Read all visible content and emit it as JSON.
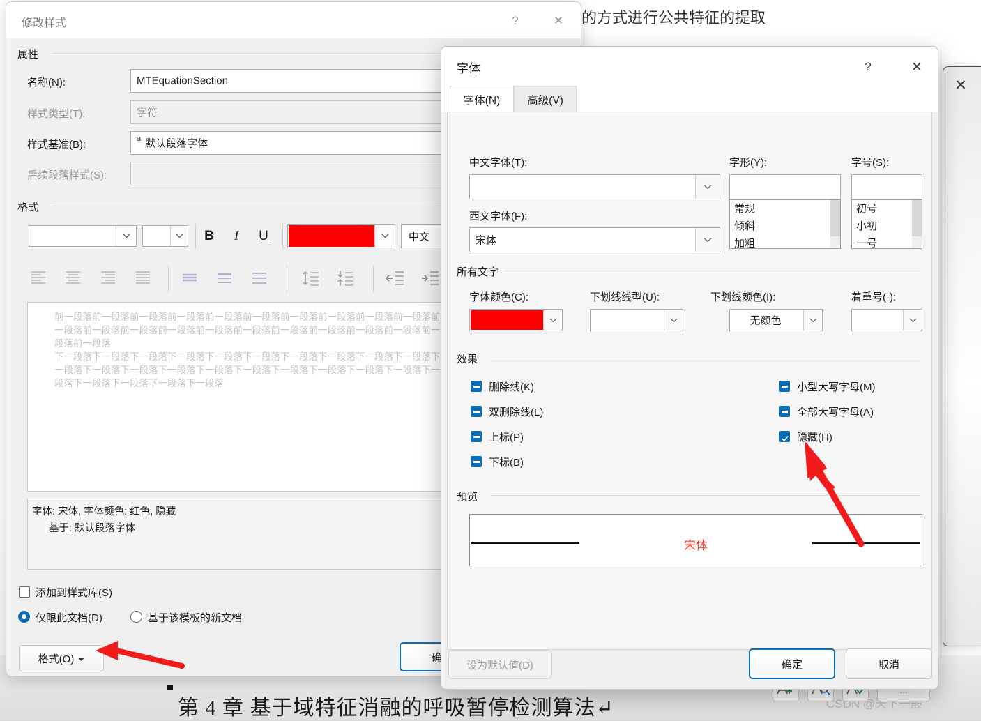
{
  "document": {
    "top_text": "的方式进行公共特征的提取",
    "heading": "第 4 章 基于域特征消融的呼吸暂停检测算法↵",
    "watermark": "CSDN @天下一般"
  },
  "style_dialog": {
    "title": "修改样式",
    "help_label": "?",
    "close_label": "✕",
    "properties": {
      "group_label": "属性",
      "fields": [
        {
          "label": "名称(N):",
          "value": "MTEquationSection",
          "disabled": false
        },
        {
          "label": "样式类型(T):",
          "value": "字符",
          "disabled": true
        },
        {
          "label": "样式基准(B):",
          "value": "默认段落字体",
          "prefix": "a",
          "disabled": false
        },
        {
          "label": "后续段落样式(S):",
          "value": "",
          "disabled": true
        }
      ]
    },
    "format": {
      "group_label": "格式",
      "font_family_value": "",
      "font_size_value": "",
      "bold_label": "B",
      "italic_label": "I",
      "underline_label": "U",
      "font_color": "#FF0000",
      "language_label": "中文",
      "align_icons": [
        "align-left-icon",
        "align-center-icon",
        "align-right-icon",
        "align-justify-icon"
      ],
      "spacing_icons": [
        "line-spacing-single-icon",
        "line-spacing-1.5-icon",
        "line-spacing-double-icon"
      ],
      "para-space_icons": [
        "space-before-icon",
        "space-after-icon"
      ],
      "indent_icons": [
        "decrease-indent-icon",
        "increase-indent-icon"
      ]
    },
    "preview_paragraph": "前一段落前一段落前一段落前一段落前一段落前一段落前一段落前一段落前一段落前一段落前一段落前一段落前一段落前一段落前一段落前一段落前一段落前一段落前一段落前一段落前一段落前一段落",
    "preview_paragraph_after": "下一段落下一段落下一段落下一段落下一段落下一段落下一段落下一段落下一段落下一段落下一段落下一段落下一段落下一段落下一段落下一段落下一段落下一段落下一段落下一段落下一段落下一段落下一段落下一段落下一段落",
    "description_line1": "字体: 宋体, 字体颜色: 红色, 隐藏",
    "description_line2": "基于: 默认段落字体",
    "add_to_gallery_label": "添加到样式库(S)",
    "add_to_gallery_checked": false,
    "scope_options": [
      {
        "label": "仅限此文档(D)",
        "selected": true
      },
      {
        "label": "基于该模板的新文档",
        "selected": false
      }
    ],
    "format_button_label": "格式(O)",
    "ok_button_label": "确定"
  },
  "font_dialog": {
    "title": "字体",
    "help_label": "?",
    "close_label": "✕",
    "tabs": [
      {
        "label": "字体(N)",
        "active": true
      },
      {
        "label": "高级(V)",
        "active": false
      }
    ],
    "chinese_font": {
      "label": "中文字体(T):",
      "value": ""
    },
    "western_font": {
      "label": "西文字体(F):",
      "value": "宋体"
    },
    "font_style": {
      "label": "字形(Y):",
      "value": "",
      "options": [
        "常规",
        "倾斜",
        "加粗"
      ]
    },
    "font_size": {
      "label": "字号(S):",
      "value": "",
      "options": [
        "初号",
        "小初",
        "一号"
      ]
    },
    "all_text": {
      "group_label": "所有文字",
      "font_color": {
        "label": "字体颜色(C):",
        "value": "",
        "swatch": "#FF0000"
      },
      "underline_style": {
        "label": "下划线线型(U):",
        "value": ""
      },
      "underline_color": {
        "label": "下划线颜色(I):",
        "value": "无颜色"
      },
      "emphasis_mark": {
        "label": "着重号(·):",
        "value": ""
      }
    },
    "effects": {
      "group_label": "效果",
      "left": [
        {
          "label": "删除线(K)",
          "state": "indeterminate"
        },
        {
          "label": "双删除线(L)",
          "state": "indeterminate"
        },
        {
          "label": "上标(P)",
          "state": "indeterminate"
        },
        {
          "label": "下标(B)",
          "state": "indeterminate"
        }
      ],
      "right": [
        {
          "label": "小型大写字母(M)",
          "state": "indeterminate"
        },
        {
          "label": "全部大写字母(A)",
          "state": "indeterminate"
        },
        {
          "label": "隐藏(H)",
          "state": "checked"
        }
      ]
    },
    "preview": {
      "group_label": "预览",
      "sample_text": "宋体",
      "sample_color": "#FF3B30"
    },
    "set_default_label": "设为默认值(D)",
    "ok_label": "确定",
    "cancel_label": "取消"
  },
  "rear_window": {
    "close_label": "✕"
  },
  "annotations": {
    "arrow_color": "#F21B1B",
    "arrow_1_target": "隐藏(H) 复选框",
    "arrow_2_target": "格式(O) 按钮"
  }
}
